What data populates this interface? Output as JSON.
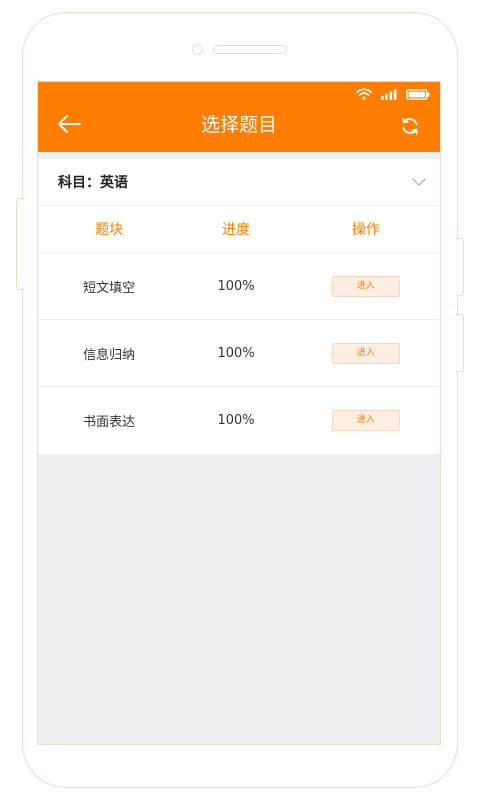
{
  "header": {
    "title": "选择题目"
  },
  "subject": {
    "label": "科目：英语"
  },
  "table": {
    "headers": [
      "题块",
      "进度",
      "操作"
    ],
    "rows": [
      {
        "block": "短文填空",
        "progress": "100%",
        "action": "进入"
      },
      {
        "block": "信息归纳",
        "progress": "100%",
        "action": "进入"
      },
      {
        "block": "书面表达",
        "progress": "100%",
        "action": "进入"
      }
    ]
  },
  "colors": {
    "accent": "#ff7d00",
    "button_bg": "#fdeee3",
    "page_bg": "#eef0f2"
  },
  "icons": {
    "back": "arrow-left-icon",
    "refresh": "refresh-icon",
    "dropdown": "chevron-down-icon",
    "wifi": "wifi-icon",
    "signal": "signal-icon",
    "battery": "battery-icon"
  }
}
